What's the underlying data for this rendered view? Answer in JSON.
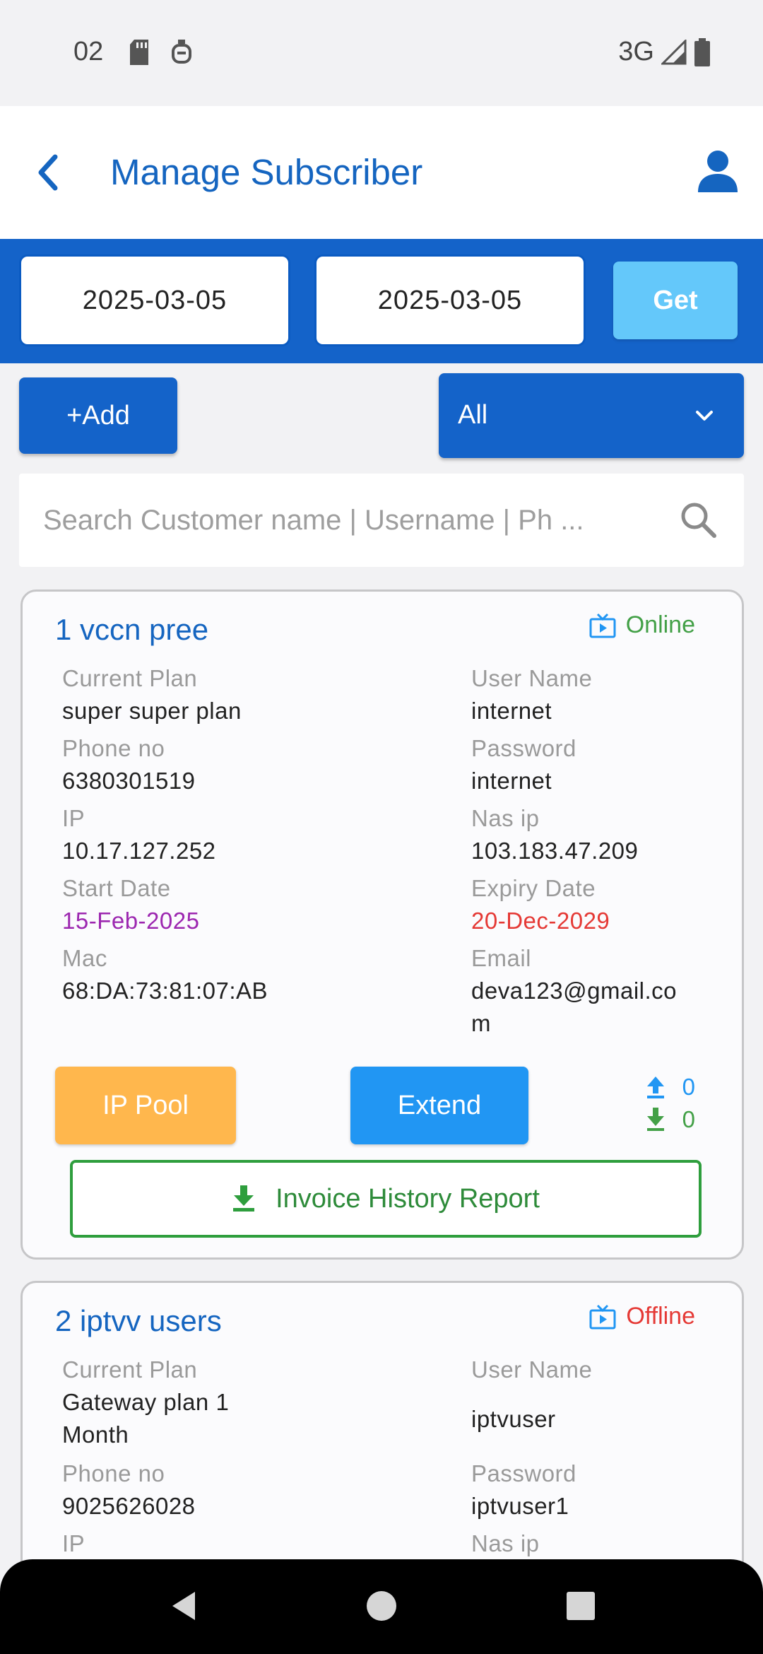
{
  "status_bar": {
    "time": "02",
    "network": "3G"
  },
  "header": {
    "title": "Manage Subscriber"
  },
  "date_filter": {
    "from_date": "2025-03-05",
    "to_date": "2025-03-05",
    "get_label": "Get"
  },
  "actions": {
    "add_label": "+Add",
    "filter_value": "All"
  },
  "search": {
    "placeholder": "Search Customer name | Username | Ph ..."
  },
  "subscribers": [
    {
      "title": "1 vccn pree",
      "status": "Online",
      "current_plan_label": "Current Plan",
      "current_plan": "super super plan",
      "username_label": "User Name",
      "username": "internet",
      "phone_label": "Phone no",
      "phone": "6380301519",
      "password_label": "Password",
      "password": "internet",
      "ip_label": "IP",
      "ip": "10.17.127.252",
      "nas_ip_label": "Nas ip",
      "nas_ip": "103.183.47.209",
      "start_date_label": "Start Date",
      "start_date": "15-Feb-2025",
      "expiry_date_label": "Expiry Date",
      "expiry_date": "20-Dec-2029",
      "mac_label": "Mac",
      "mac": "68:DA:73:81:07:AB",
      "email_label": "Email",
      "email": "deva123@gmail.com",
      "ip_pool_label": "IP Pool",
      "extend_label": "Extend",
      "upload": "0",
      "download": "0",
      "invoice_label": "Invoice History Report"
    },
    {
      "title": "2 iptvv users",
      "status": "Offline",
      "current_plan_label": "Current Plan",
      "current_plan": "Gateway plan 1 Month",
      "username_label": "User Name",
      "username": "iptvuser",
      "phone_label": "Phone no",
      "phone": "9025626028",
      "password_label": "Password",
      "password": "iptvuser1",
      "ip_label": "IP",
      "nas_ip_label": "Nas ip"
    }
  ],
  "colors": {
    "primary": "#1463c9",
    "title_blue": "#1565c0",
    "get_button": "#64c8fa",
    "online": "#43a047",
    "offline": "#e53935",
    "start_date": "#9c27b0",
    "expiry_date": "#e53935",
    "ip_pool": "#ffb74d",
    "extend": "#2196f3",
    "invoice_border": "#2e9e3d"
  },
  "icons": {
    "back": "chevron-left-icon",
    "user": "person-icon",
    "filter": "chevron-down-icon",
    "search": "search-icon",
    "status": "tv-icon",
    "upload": "upload-arrow-icon",
    "download": "download-arrow-icon",
    "invoice": "download-icon"
  }
}
